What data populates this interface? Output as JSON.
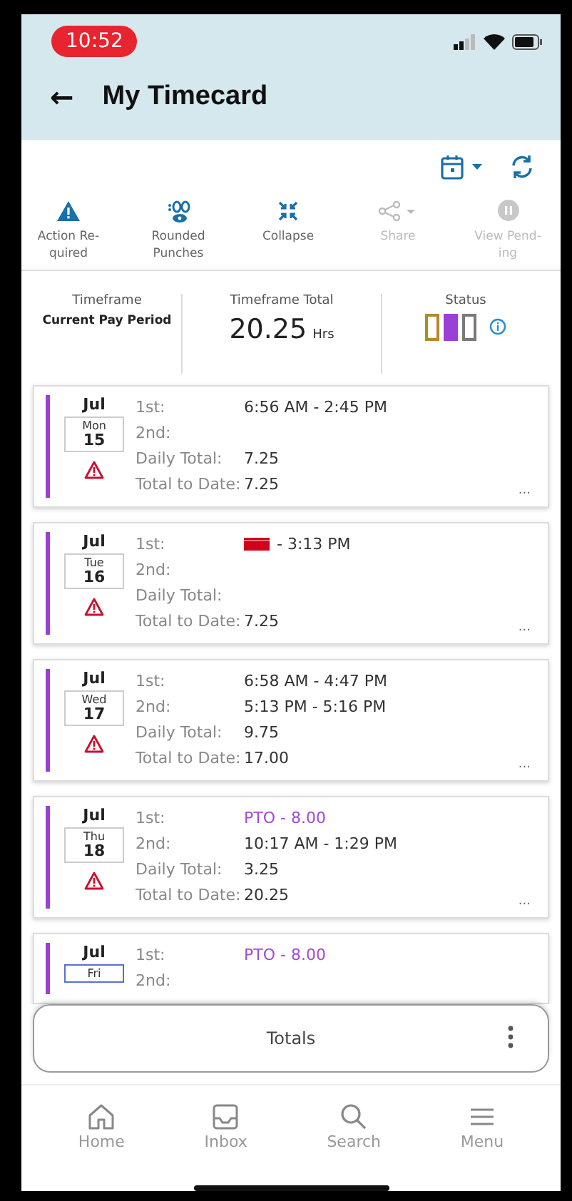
{
  "status_bar": {
    "time": "10:52"
  },
  "header": {
    "back": "←",
    "title": "My Timecard"
  },
  "actions": [
    {
      "label": "Action Re-quired",
      "disabled": false
    },
    {
      "label": "Rounded Punches",
      "disabled": false
    },
    {
      "label": "Collapse",
      "disabled": false
    },
    {
      "label": "Share",
      "disabled": true
    },
    {
      "label": "View Pend-ing",
      "disabled": true
    }
  ],
  "summary": {
    "timeframe_label": "Timeframe",
    "timeframe": "Current Pay Period",
    "total_label": "Timeframe Total",
    "total": "20.25",
    "total_unit": "Hrs",
    "status_label": "Status",
    "status_steps": [
      {
        "color": "#b8862b",
        "filled": false
      },
      {
        "color": "#9b3fd6",
        "filled": true
      },
      {
        "color": "#7a7a7a",
        "filled": false
      }
    ]
  },
  "days": [
    {
      "month": "Jul",
      "weekday": "Mon",
      "day": "15",
      "today": false,
      "warning": true,
      "more": "...",
      "rows": [
        {
          "label": "1st:",
          "kind": "punch",
          "value": "6:56 AM - 2:45 PM"
        },
        {
          "label": "2nd:",
          "kind": "empty"
        },
        {
          "label": "Daily Total:",
          "kind": "punch",
          "value": "7.25"
        },
        {
          "label": "Total to Date:",
          "kind": "punch",
          "value": "7.25"
        }
      ]
    },
    {
      "month": "Jul",
      "weekday": "Tue",
      "day": "16",
      "today": false,
      "warning": true,
      "more": "...",
      "rows": [
        {
          "label": "1st:",
          "kind": "missing",
          "value": "- 3:13 PM"
        },
        {
          "label": "2nd:",
          "kind": "empty"
        },
        {
          "label": "Daily Total:",
          "kind": "empty"
        },
        {
          "label": "Total to Date:",
          "kind": "punch",
          "value": "7.25"
        }
      ]
    },
    {
      "month": "Jul",
      "weekday": "Wed",
      "day": "17",
      "today": false,
      "warning": true,
      "more": "...",
      "rows": [
        {
          "label": "1st:",
          "kind": "punch",
          "value": "6:58 AM - 4:47 PM"
        },
        {
          "label": "2nd:",
          "kind": "punch",
          "value": "5:13 PM - 5:16 PM"
        },
        {
          "label": "Daily Total:",
          "kind": "punch",
          "value": "9.75"
        },
        {
          "label": "Total to Date:",
          "kind": "punch",
          "value": "17.00"
        }
      ]
    },
    {
      "month": "Jul",
      "weekday": "Thu",
      "day": "18",
      "today": false,
      "warning": true,
      "more": "...",
      "rows": [
        {
          "label": "1st:",
          "kind": "pto",
          "value": "PTO - 8.00"
        },
        {
          "label": "2nd:",
          "kind": "punch",
          "value": "10:17 AM - 1:29 PM"
        },
        {
          "label": "Daily Total:",
          "kind": "punch",
          "value": "3.25"
        },
        {
          "label": "Total to Date:",
          "kind": "punch",
          "value": "20.25"
        }
      ]
    },
    {
      "month": "Jul",
      "weekday": "Fri",
      "today": true,
      "warning": false,
      "rows": [
        {
          "label": "1st:",
          "kind": "pto",
          "value": "PTO - 8.00"
        },
        {
          "label": "2nd:",
          "kind": "empty"
        }
      ]
    }
  ],
  "totals_bar": {
    "label": "Totals"
  },
  "nav": [
    {
      "label": "Home"
    },
    {
      "label": "Inbox"
    },
    {
      "label": "Search"
    },
    {
      "label": "Menu"
    }
  ]
}
